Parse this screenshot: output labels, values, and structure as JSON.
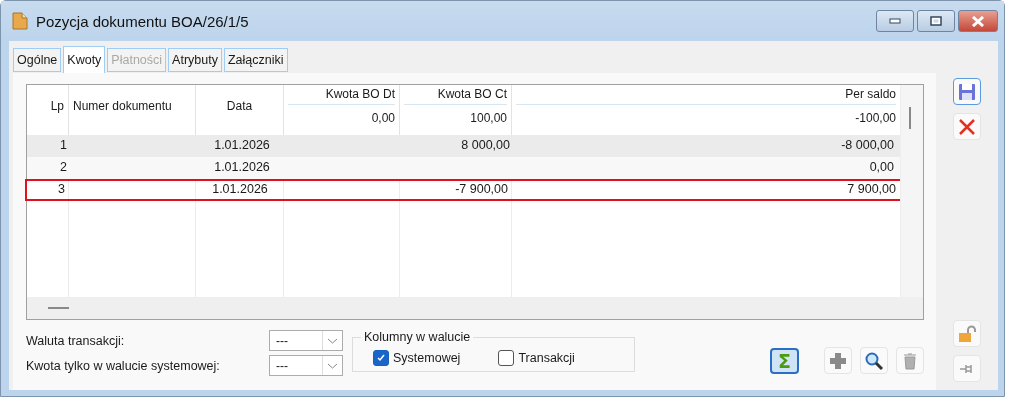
{
  "window": {
    "title": "Pozycja dokumentu BOA/26/1/5"
  },
  "tabs": [
    {
      "label": "Ogólne",
      "selected": false,
      "disabled": false
    },
    {
      "label": "Kwoty",
      "selected": true,
      "disabled": false
    },
    {
      "label": "Płatności",
      "selected": false,
      "disabled": true
    },
    {
      "label": "Atrybuty",
      "selected": false,
      "disabled": false
    },
    {
      "label": "Załączniki",
      "selected": false,
      "disabled": false
    }
  ],
  "table": {
    "columns": [
      {
        "label": "Lp"
      },
      {
        "label": "Numer dokumentu"
      },
      {
        "label": "Data"
      },
      {
        "label": "Kwota BO Dt",
        "total": "0,00"
      },
      {
        "label": "Kwota BO Ct",
        "total": "100,00"
      },
      {
        "label": "Per saldo",
        "total": "-100,00"
      }
    ],
    "rows": [
      {
        "cells": [
          "1",
          "",
          "1.01.2026",
          "",
          "8 000,00",
          "-8 000,00"
        ],
        "selected": true,
        "outlined": false
      },
      {
        "cells": [
          "2",
          "",
          "1.01.2026",
          "",
          "",
          "0,00"
        ],
        "selected": false,
        "outlined": false
      },
      {
        "cells": [
          "3",
          "",
          "1.01.2026",
          "",
          "-7 900,00",
          "7 900,00"
        ],
        "selected": false,
        "outlined": true
      }
    ]
  },
  "fields": [
    {
      "label": "Waluta transakcji:",
      "value": "---"
    },
    {
      "label": "Kwota tylko w walucie systemowej:",
      "value": "---"
    }
  ],
  "currency_columns": {
    "title": "Kolumny w walucie",
    "options": [
      {
        "label": "Systemowej",
        "checked": true
      },
      {
        "label": "Transakcji",
        "checked": false
      }
    ]
  },
  "sum_button": {
    "label": "Σ",
    "selected": true
  }
}
